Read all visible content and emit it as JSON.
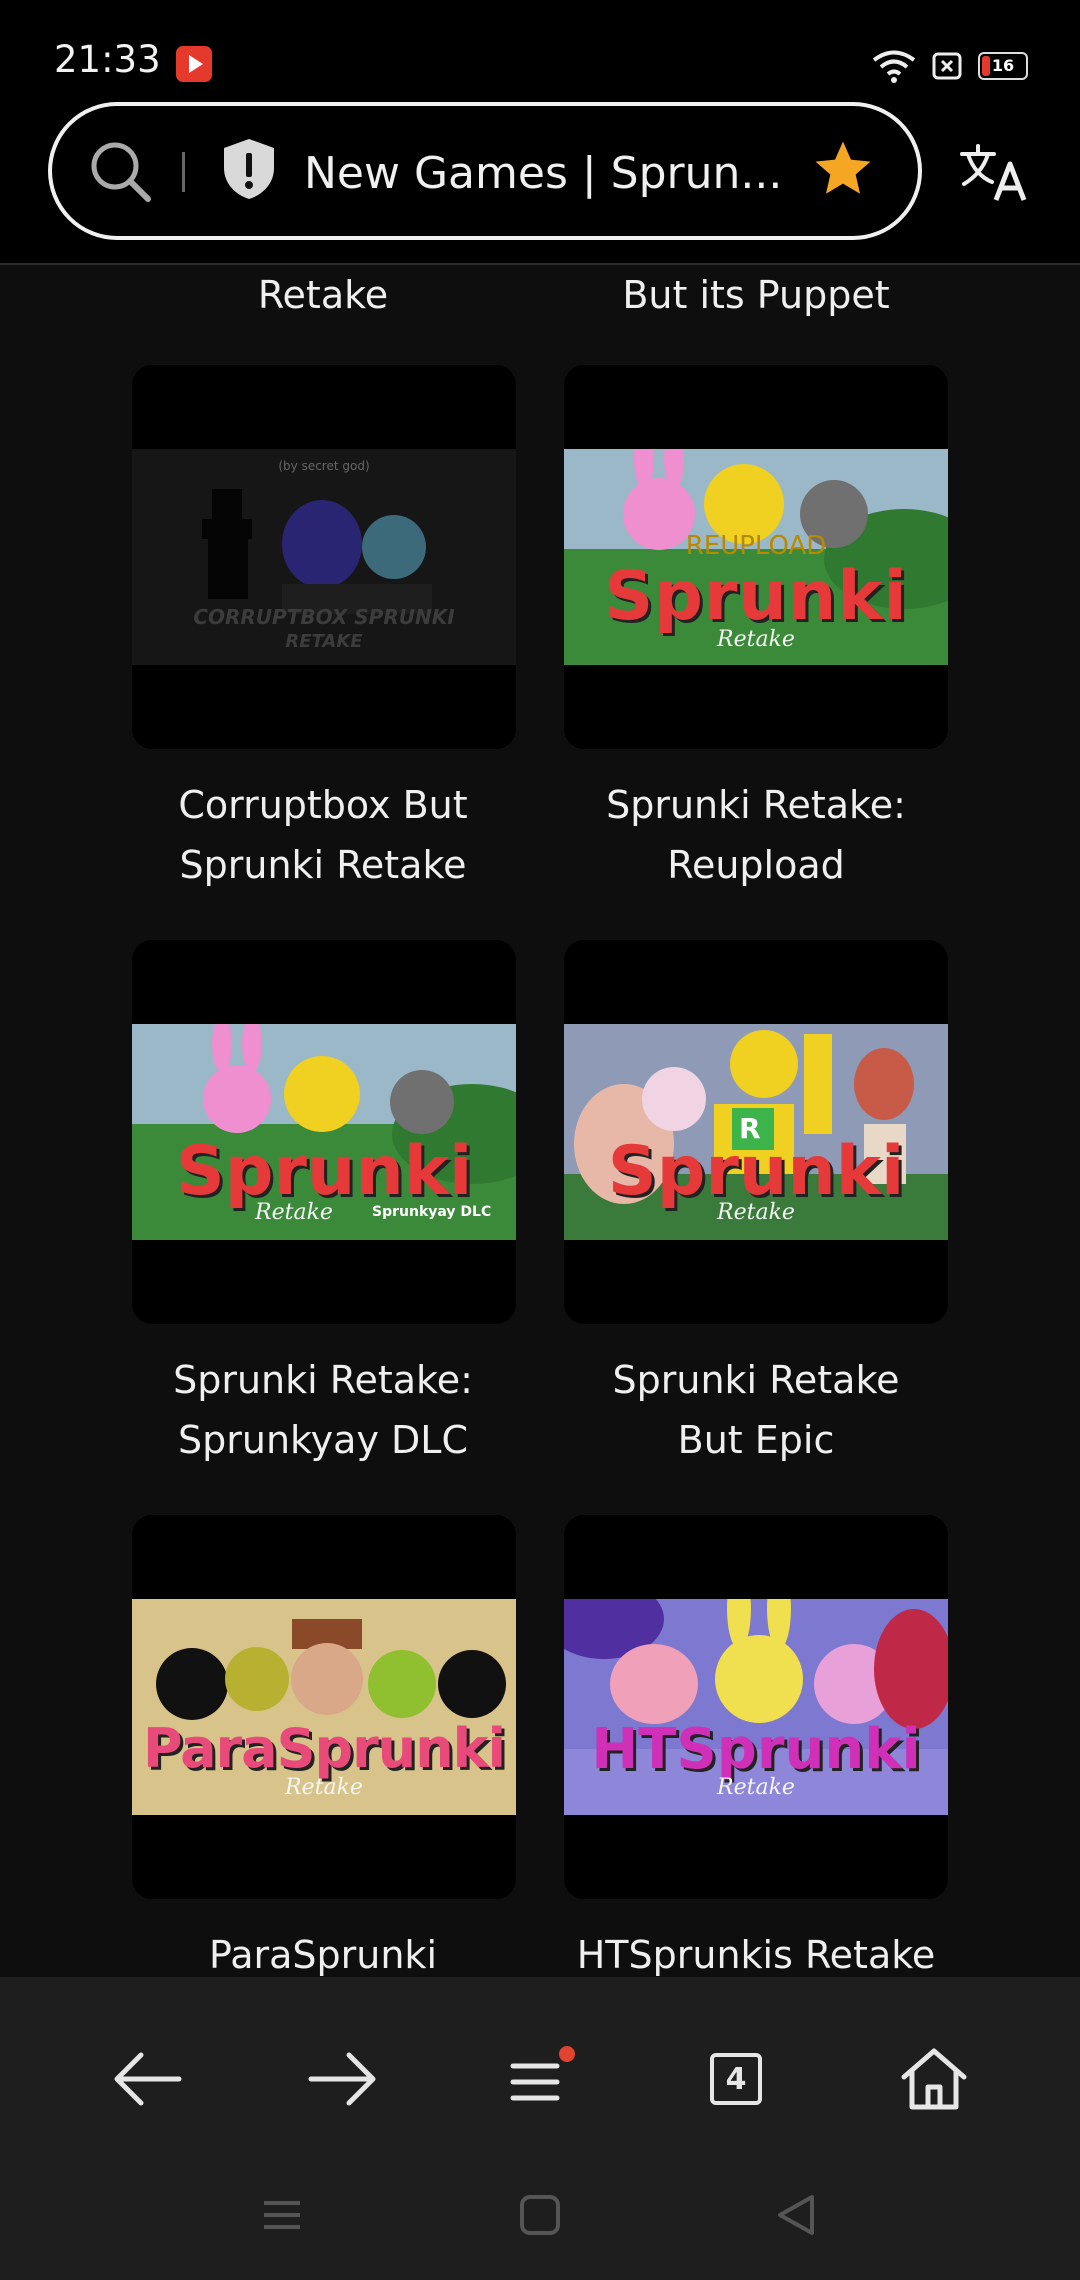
{
  "status_bar": {
    "time": "21:33",
    "battery_level": "16"
  },
  "address_bar": {
    "title": "New Games | Sprun..."
  },
  "partial_titles": [
    "Retake",
    "But its Puppet"
  ],
  "games": [
    {
      "title_line1": "Corruptbox But",
      "title_line2": "Sprunki Retake",
      "thumb": {
        "top_text": "(by secret god)",
        "main_text": "CORRUPTBOX SPRUNKI",
        "sub_text": "RETAKE"
      }
    },
    {
      "title_line1": "Sprunki Retake:",
      "title_line2": "Reupload",
      "thumb": {
        "top_text": "REUPLOAD",
        "main_text": "Sprunki",
        "sub_text": "Retake"
      }
    },
    {
      "title_line1": "Sprunki Retake:",
      "title_line2": "Sprunkyay DLC",
      "thumb": {
        "top_text": "",
        "main_text": "Sprunki",
        "sub_text": "Retake",
        "extra_text": "Sprunkyay DLC"
      }
    },
    {
      "title_line1": "Sprunki Retake",
      "title_line2": "But Epic",
      "thumb": {
        "top_text": "R",
        "main_text": "Sprunki",
        "sub_text": "Retake"
      }
    },
    {
      "title_line1": "ParaSprunki",
      "title_line2": "",
      "thumb": {
        "top_text": "",
        "main_text": "ParaSprunki",
        "sub_text": "Retake"
      }
    },
    {
      "title_line1": "HTSprunkis Retake",
      "title_line2": "",
      "thumb": {
        "top_text": "",
        "main_text": "HTSprunki",
        "sub_text": "Retake"
      }
    }
  ],
  "bottom_nav": {
    "tab_count": "4"
  },
  "colors": {
    "star": "#f5a623",
    "notification_dot": "#e0442f",
    "battery_low": "#e53a2b"
  }
}
